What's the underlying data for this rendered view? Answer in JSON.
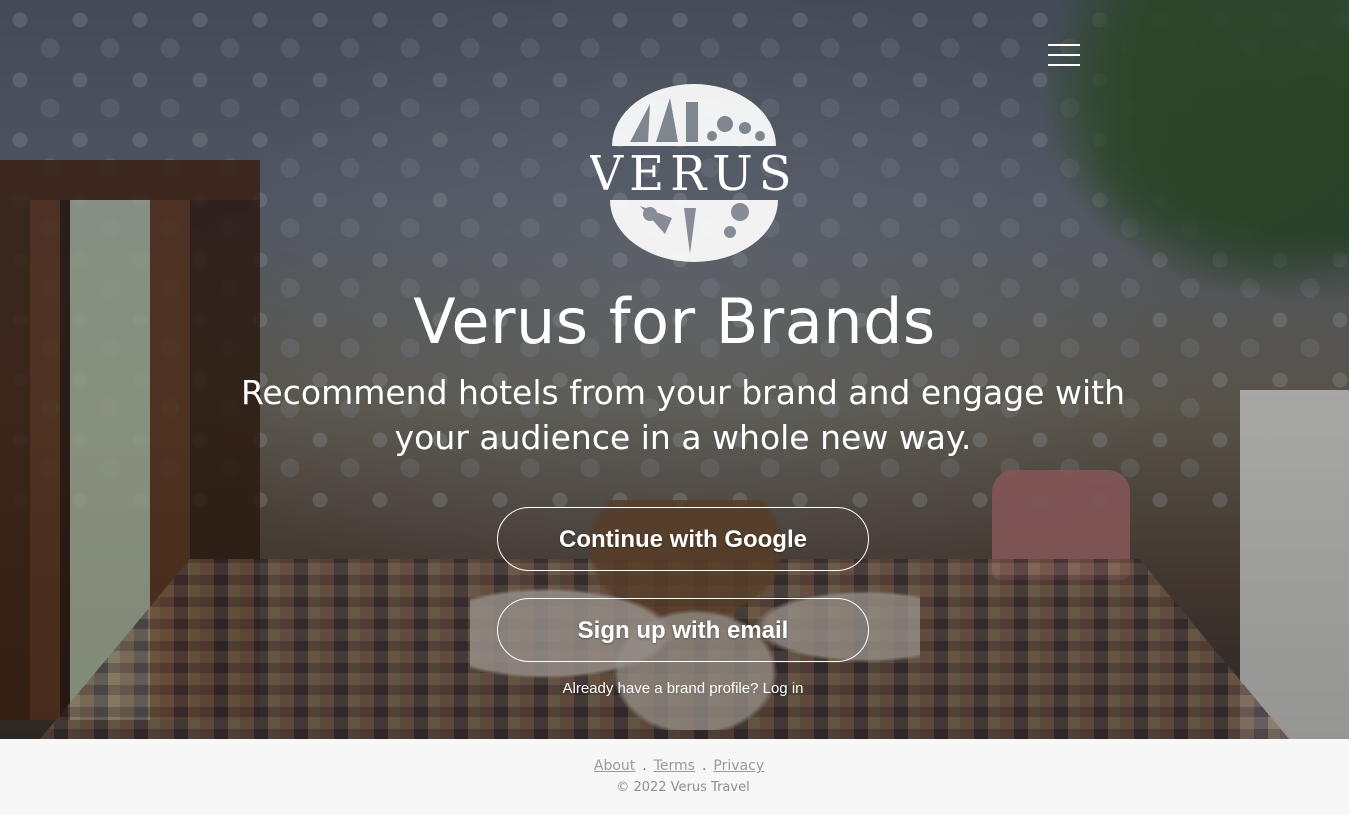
{
  "hero": {
    "title": "Verus for Brands",
    "subtitle": "Recommend hotels from your brand and engage with your audience in a whole new way.",
    "logo_text": "VERUS"
  },
  "nav": {
    "menu_icon": "hamburger-menu-icon"
  },
  "actions": {
    "google_label": "Continue with Google",
    "email_label": "Sign up with email",
    "login_prompt": "Already have a brand profile?",
    "login_link": "Log in"
  },
  "footer": {
    "links": [
      "About",
      "Terms",
      "Privacy"
    ],
    "separator": ".",
    "copyright": "© 2022 Verus Travel"
  },
  "colors": {
    "text_on_hero": "#ffffff",
    "footer_bg": "#f7f7f7",
    "footer_text": "#9a9a9a"
  }
}
